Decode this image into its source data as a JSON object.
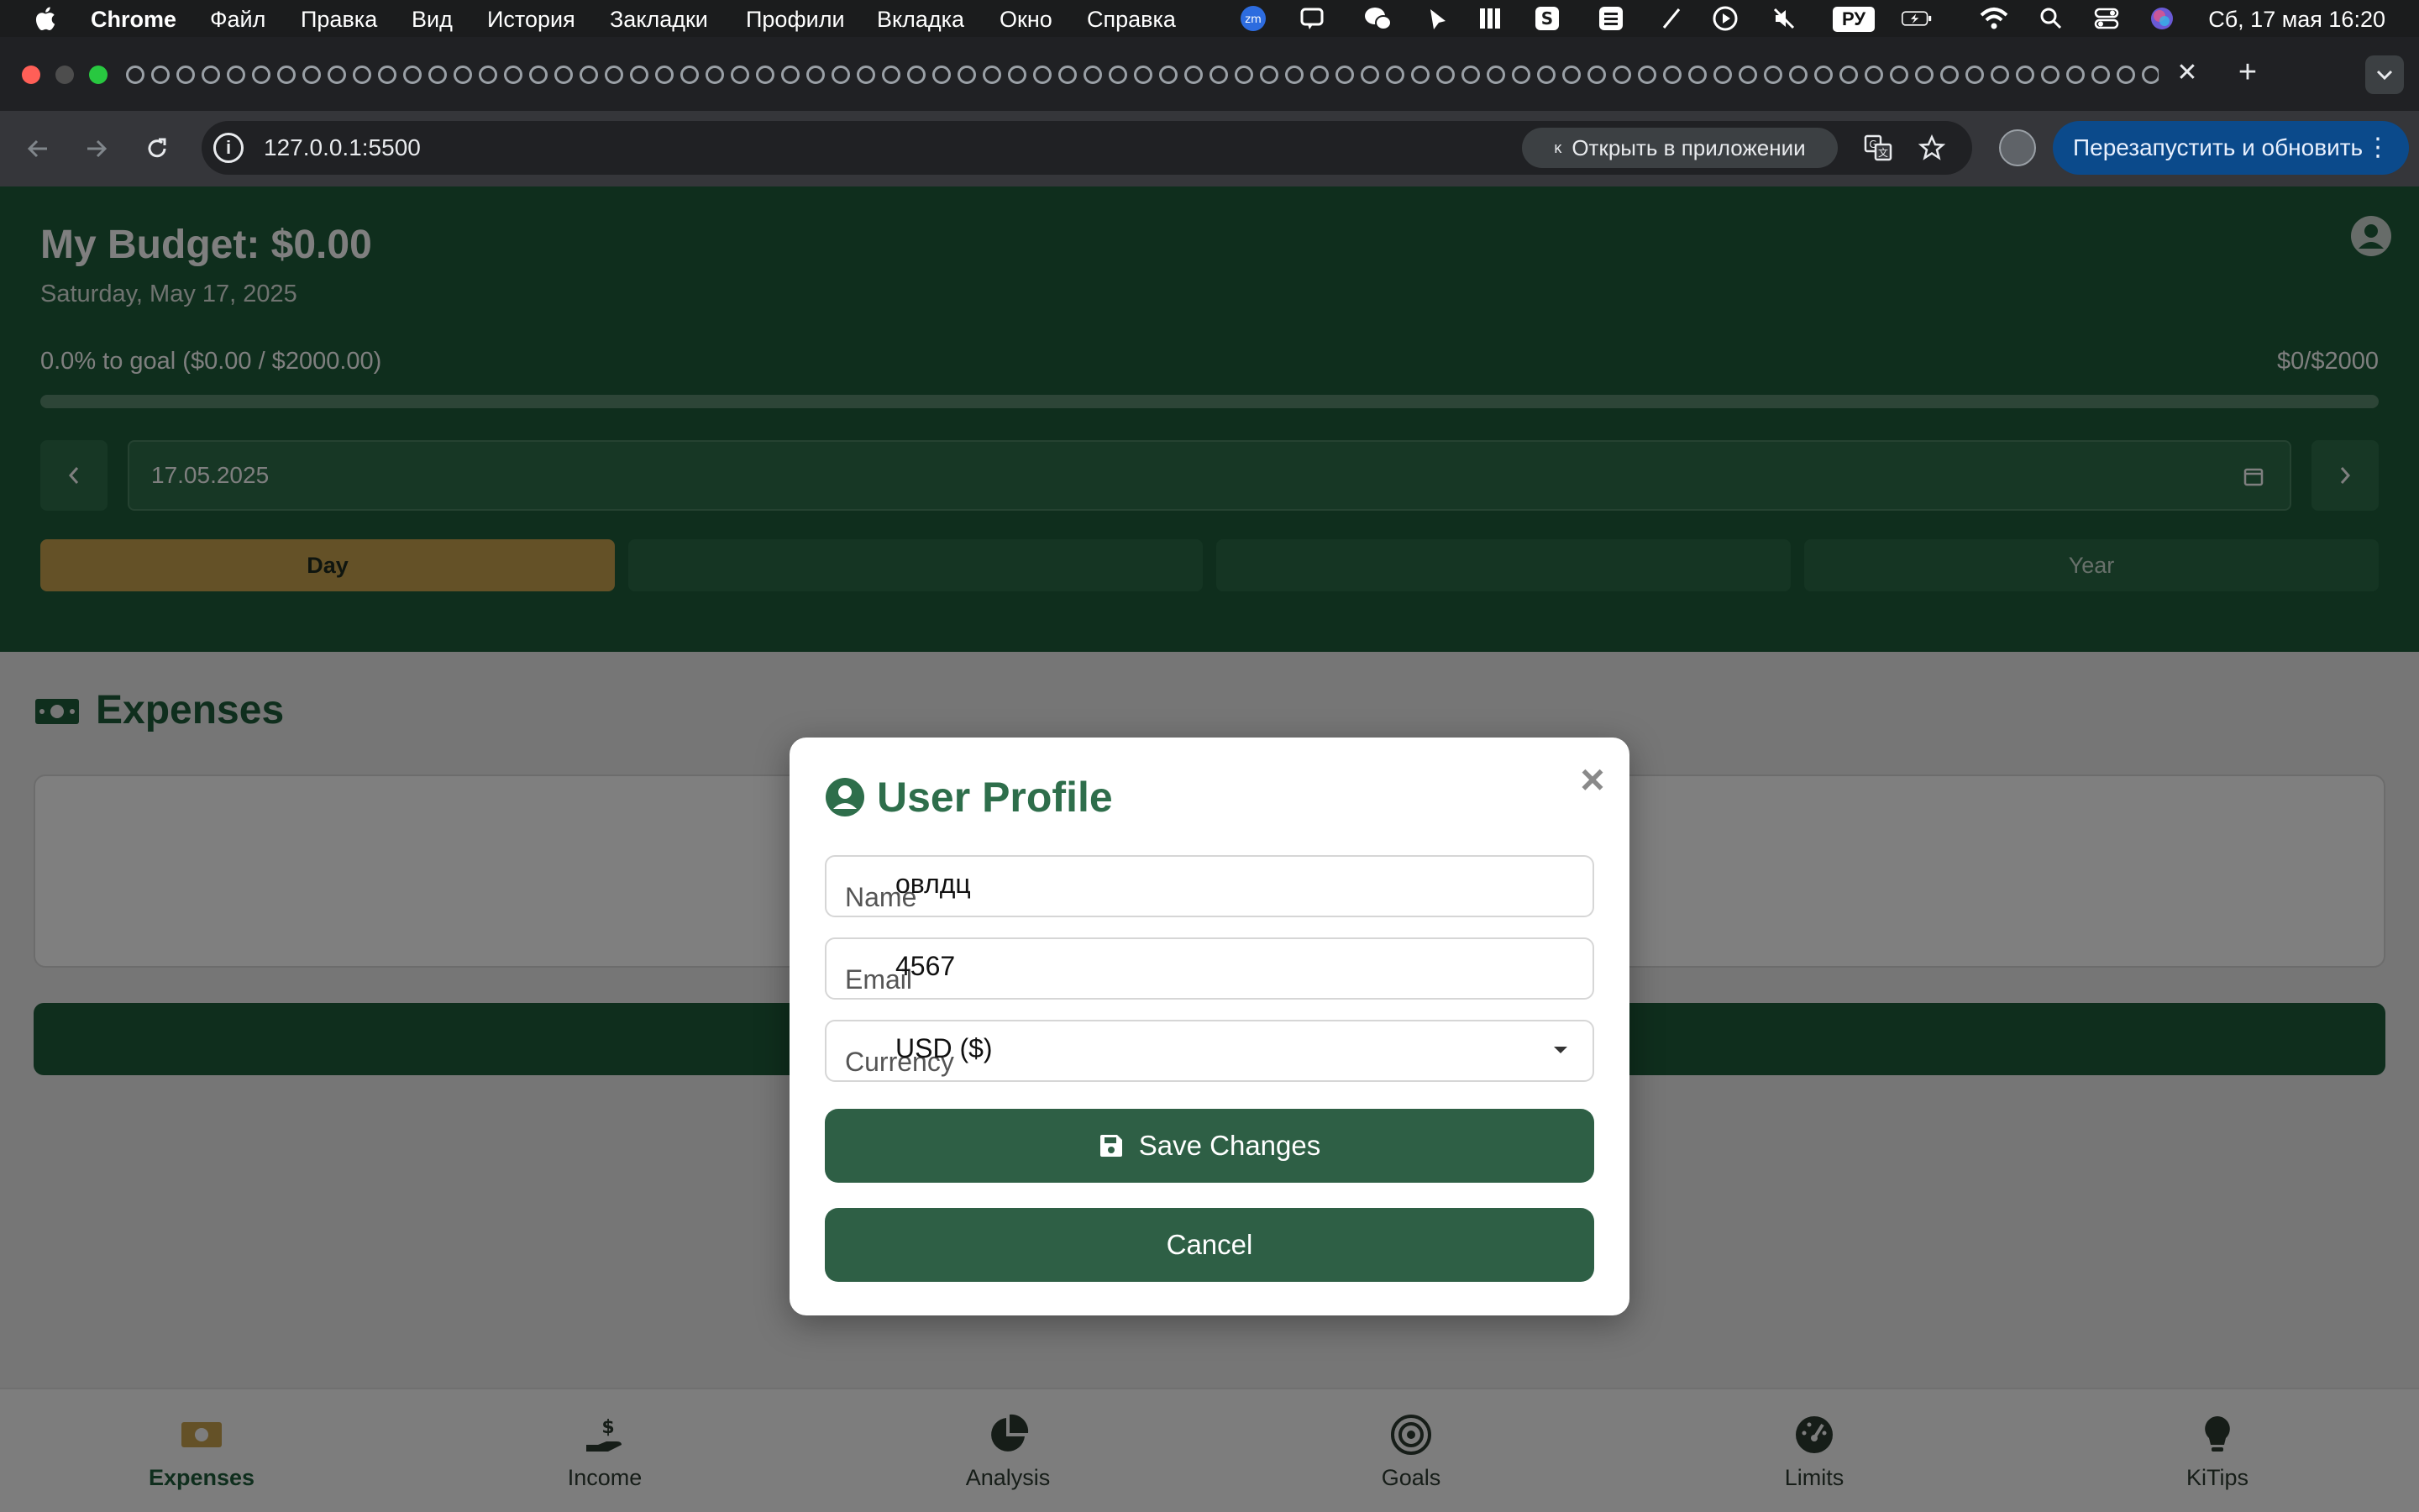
{
  "menubar": {
    "app_name": "Chrome",
    "items": [
      "Файл",
      "Правка",
      "Вид",
      "История",
      "Закладки",
      "Профили",
      "Вкладка",
      "Окно",
      "Справка"
    ],
    "status_icons": [
      "zoom-icon",
      "chat-icon",
      "wechat-icon",
      "pin-icon",
      "bars-icon",
      "s-icon",
      "list-icon",
      "slash-icon",
      "play-icon",
      "mute-icon"
    ],
    "keyboard_layout": "РУ",
    "clock": "Сб, 17 мая  16:20"
  },
  "browser": {
    "url": "127.0.0.1:5500",
    "open_in_app_label": "Открыть в приложении",
    "relaunch_label": "Перезапустить и обновить"
  },
  "app": {
    "title": "My Budget: $0.00",
    "date": "Saturday, May 17, 2025",
    "goal_text": "0.0% to goal ($0.00 / $2000.00)",
    "goal_amount": "$0/$2000",
    "goal_progress": 0,
    "date_value": "17.05.2025",
    "periods": [
      {
        "label": "Day",
        "active": true
      },
      {
        "label": "",
        "active": false
      },
      {
        "label": "",
        "active": false
      },
      {
        "label": "Year",
        "active": false
      }
    ],
    "section_title": "Expenses",
    "accent_color": "#1f5d3a",
    "highlight_color": "#c9a24f"
  },
  "bottom_nav": [
    {
      "label": "Expenses",
      "icon": "money-bill-icon",
      "active": true
    },
    {
      "label": "Income",
      "icon": "hand-dollar-icon",
      "active": false
    },
    {
      "label": "Analysis",
      "icon": "pie-chart-icon",
      "active": false
    },
    {
      "label": "Goals",
      "icon": "target-icon",
      "active": false
    },
    {
      "label": "Limits",
      "icon": "gauge-icon",
      "active": false
    },
    {
      "label": "KiTips",
      "icon": "lightbulb-icon",
      "active": false
    }
  ],
  "modal": {
    "title": "User Profile",
    "name_label": "Name",
    "name_value": "овлдц",
    "email_label": "Email",
    "email_value": "4567",
    "currency_label": "Currency",
    "currency_value": "USD ($)",
    "save_label": "Save Changes",
    "cancel_label": "Cancel"
  }
}
